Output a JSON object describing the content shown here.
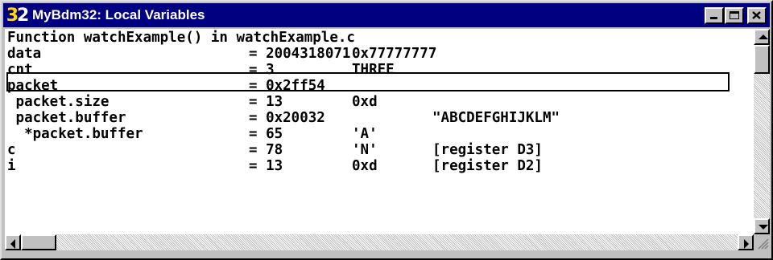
{
  "window": {
    "title": "MyBdm32: Local Variables",
    "icon": {
      "name": "app-32-icon",
      "digit1": "3",
      "digit2": "2"
    }
  },
  "header_line": "Function watchExample() in watchExample.c",
  "variables": [
    {
      "name": "data",
      "eq": "= 2004318071",
      "v2": "0x77777777",
      "v3": ""
    },
    {
      "name": "cnt",
      "eq": "= 3",
      "v2": "THREE",
      "v3": ""
    },
    {
      "name": "packet",
      "eq": "= 0x2ff54",
      "v2": "",
      "v3": ""
    },
    {
      "name": " packet.size",
      "eq": "= 13",
      "v2": "0xd",
      "v3": ""
    },
    {
      "name": " packet.buffer",
      "eq": "= 0x20032",
      "v2": "",
      "v3": "\"ABCDEFGHIJKLM\""
    },
    {
      "name": "  *packet.buffer",
      "eq": "= 65",
      "v2": "'A'",
      "v3": ""
    },
    {
      "name": "c",
      "eq": "= 78",
      "v2": "'N'",
      "v3": "[register D3]"
    },
    {
      "name": "i",
      "eq": "= 13",
      "v2": "0xd",
      "v3": "[register D2]"
    }
  ],
  "selected_row": "cnt",
  "colors": {
    "titlebar": "#000080",
    "face": "#c0c0c0",
    "client": "#ffffff"
  }
}
